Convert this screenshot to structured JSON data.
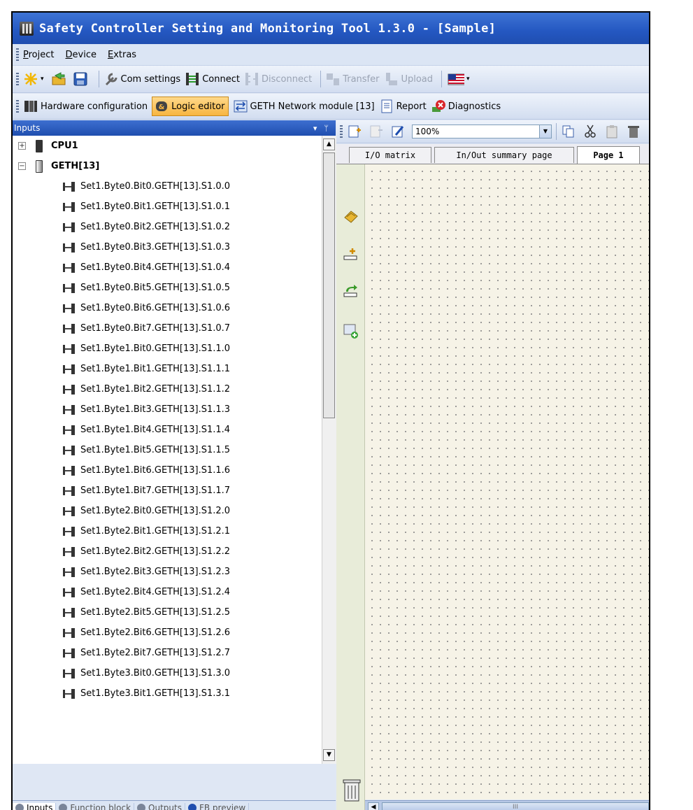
{
  "window": {
    "title": "Safety Controller Setting and Monitoring Tool 1.3.0 - [Sample]"
  },
  "menu": [
    {
      "label": "Project",
      "accel": "P",
      "rest": "roject"
    },
    {
      "label": "Device",
      "accel": "D",
      "rest": "evice"
    },
    {
      "label": "Extras",
      "accel": "E",
      "rest": "xtras"
    }
  ],
  "toolbar": {
    "com_settings": "Com settings",
    "connect": "Connect",
    "disconnect": "Disconnect",
    "transfer": "Transfer",
    "upload": "Upload"
  },
  "viewbar": {
    "hardware_configuration": "Hardware configuration",
    "logic_editor": "Logic editor",
    "geth_network_module": "GETH Network module [13]",
    "report": "Report",
    "diagnostics": "Diagnostics"
  },
  "left_panel": {
    "title": "Inputs",
    "tree": {
      "cpu": "CPU1",
      "geth": "GETH[13]",
      "items": [
        "Set1.Byte0.Bit0.GETH[13].S1.0.0",
        "Set1.Byte0.Bit1.GETH[13].S1.0.1",
        "Set1.Byte0.Bit2.GETH[13].S1.0.2",
        "Set1.Byte0.Bit3.GETH[13].S1.0.3",
        "Set1.Byte0.Bit4.GETH[13].S1.0.4",
        "Set1.Byte0.Bit5.GETH[13].S1.0.5",
        "Set1.Byte0.Bit6.GETH[13].S1.0.6",
        "Set1.Byte0.Bit7.GETH[13].S1.0.7",
        "Set1.Byte1.Bit0.GETH[13].S1.1.0",
        "Set1.Byte1.Bit1.GETH[13].S1.1.1",
        "Set1.Byte1.Bit2.GETH[13].S1.1.2",
        "Set1.Byte1.Bit3.GETH[13].S1.1.3",
        "Set1.Byte1.Bit4.GETH[13].S1.1.4",
        "Set1.Byte1.Bit5.GETH[13].S1.1.5",
        "Set1.Byte1.Bit6.GETH[13].S1.1.6",
        "Set1.Byte1.Bit7.GETH[13].S1.1.7",
        "Set1.Byte2.Bit0.GETH[13].S1.2.0",
        "Set1.Byte2.Bit1.GETH[13].S1.2.1",
        "Set1.Byte2.Bit2.GETH[13].S1.2.2",
        "Set1.Byte2.Bit3.GETH[13].S1.2.3",
        "Set1.Byte2.Bit4.GETH[13].S1.2.4",
        "Set1.Byte2.Bit5.GETH[13].S1.2.5",
        "Set1.Byte2.Bit6.GETH[13].S1.2.6",
        "Set1.Byte2.Bit7.GETH[13].S1.2.7",
        "Set1.Byte3.Bit0.GETH[13].S1.3.0",
        "Set1.Byte3.Bit1.GETH[13].S1.3.1"
      ]
    },
    "bottom_tabs": [
      "Inputs",
      "Function block",
      "Outputs",
      "FB preview"
    ]
  },
  "editor": {
    "zoom": "100%",
    "tabs": [
      "I/O matrix",
      "In/Out summary page",
      "Page 1"
    ],
    "selected_tab": "Page 1"
  },
  "colors": {
    "titlebar": "#2457c1",
    "canvas": "#f6f3e7",
    "active_view": "#f7b541"
  }
}
